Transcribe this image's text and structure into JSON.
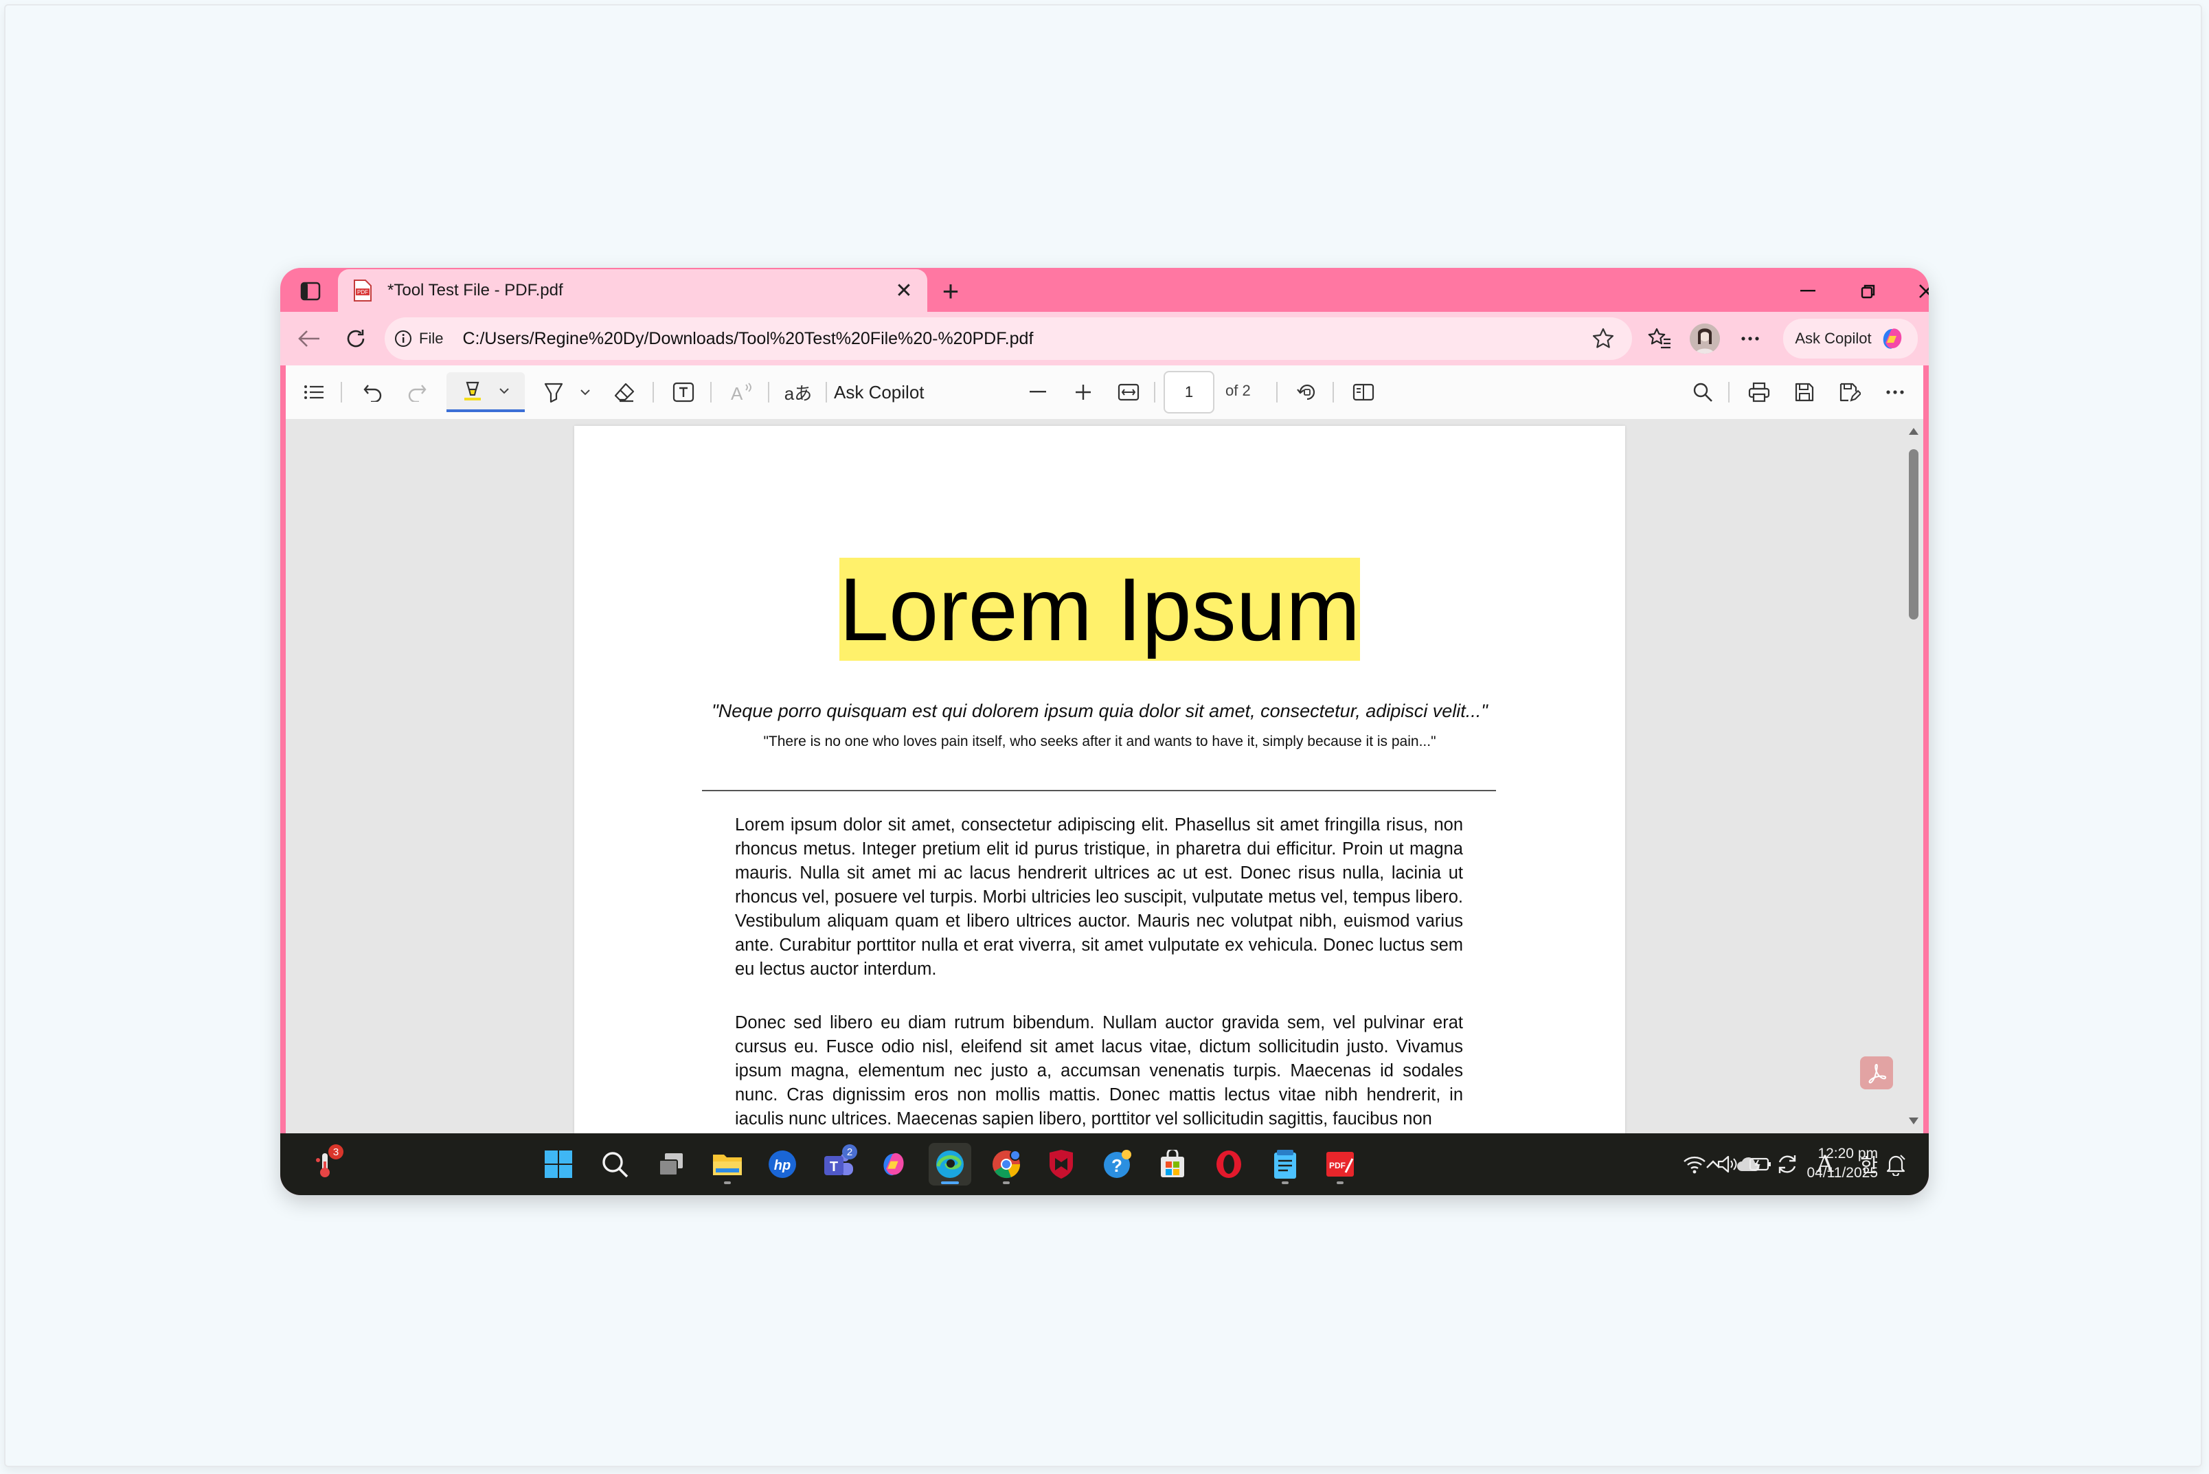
{
  "browser": {
    "tab_title": "*Tool Test File - PDF.pdf",
    "url_scheme_label": "File",
    "url": "C:/Users/Regine%20Dy/Downloads/Tool%20Test%20File%20-%20PDF.pdf",
    "ask_copilot_label": "Ask Copilot",
    "new_tab_label": "+",
    "tab_close_label": "✕"
  },
  "pdf_toolbar": {
    "ask_copilot_label": "Ask Copilot",
    "current_page": "1",
    "page_total_label": "of 2",
    "translate_label": "aあ"
  },
  "document": {
    "title": "Lorem Ipsum",
    "quote_latin": "\"Neque porro quisquam est qui dolorem ipsum quia dolor sit amet, consectetur, adipisci velit...\"",
    "quote_english": "\"There is no one who loves pain itself, who seeks after it and wants to have it, simply because it is pain...\"",
    "paragraph_1": "Lorem ipsum dolor sit amet, consectetur adipiscing elit. Phasellus sit amet fringilla risus, non rhoncus metus. Integer pretium elit id purus tristique, in pharetra dui efficitur. Proin ut magna mauris. Nulla sit amet mi ac lacus hendrerit ultrices ac ut est. Donec risus nulla, lacinia ut rhoncus vel, posuere vel turpis. Morbi ultricies leo suscipit, vulputate metus vel, tempus libero. Vestibulum aliquam quam et libero ultrices auctor. Mauris nec volutpat nibh, euismod varius ante. Curabitur porttitor nulla et erat viverra, sit amet vulputate ex vehicula. Donec luctus sem eu lectus auctor interdum.",
    "paragraph_2": "Donec sed libero eu diam rutrum bibendum. Nullam auctor gravida sem, vel pulvinar erat cursus eu. Fusce odio nisl, eleifend sit amet lacus vitae, dictum sollicitudin justo. Vivamus ipsum magna, elementum nec justo a, accumsan venenatis turpis. Maecenas id sodales nunc. Cras dignissim eros non mollis mattis. Donec mattis lectus vitae nibh hendrerit, in iaculis nunc ultrices. Maecenas sapien libero, porttitor vel sollicitudin sagittis, faucibus non"
  },
  "taskbar": {
    "weather_badge": "3",
    "teams_badge": "2",
    "ime_label": "한",
    "font_label": "A",
    "clock_time": "12:20 pm",
    "clock_date": "04/11/2025"
  },
  "colors": {
    "window_frame": "#ff77a2",
    "tab_active": "#ffd0e0",
    "highlight": "#fff16b",
    "taskbar": "#1d1e1a"
  }
}
